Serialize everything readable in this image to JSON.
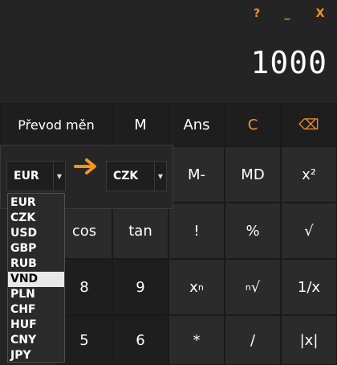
{
  "window": {
    "help_label": "?",
    "minimize_label": "_",
    "close_label": "X"
  },
  "display": {
    "value": "1000"
  },
  "buttons": {
    "convert": "Převod měn",
    "m": "M",
    "ans": "Ans",
    "clear": "C",
    "backspace": "⌫",
    "m_minus": "M-",
    "md": "MD",
    "square": "x²",
    "cos": "cos",
    "tan": "tan",
    "factorial": "!",
    "percent": "%",
    "sqrt": "√",
    "eight": "8",
    "nine": "9",
    "pow_base": "x",
    "pow_exp": "n",
    "root_index": "n",
    "root_sign": "√",
    "reciprocal": "1/x",
    "five": "5",
    "six": "6",
    "multiply": "*",
    "divide": "/",
    "abs": "|x|"
  },
  "converter": {
    "from_value": "EUR",
    "to_value": "CZK",
    "dropdown_options": [
      "EUR",
      "CZK",
      "USD",
      "GBP",
      "RUB",
      "VND",
      "PLN",
      "CHF",
      "HUF",
      "CNY",
      "JPY"
    ],
    "highlighted_option": "VND"
  },
  "colors": {
    "accent": "#f7931e",
    "background": "#242424"
  }
}
